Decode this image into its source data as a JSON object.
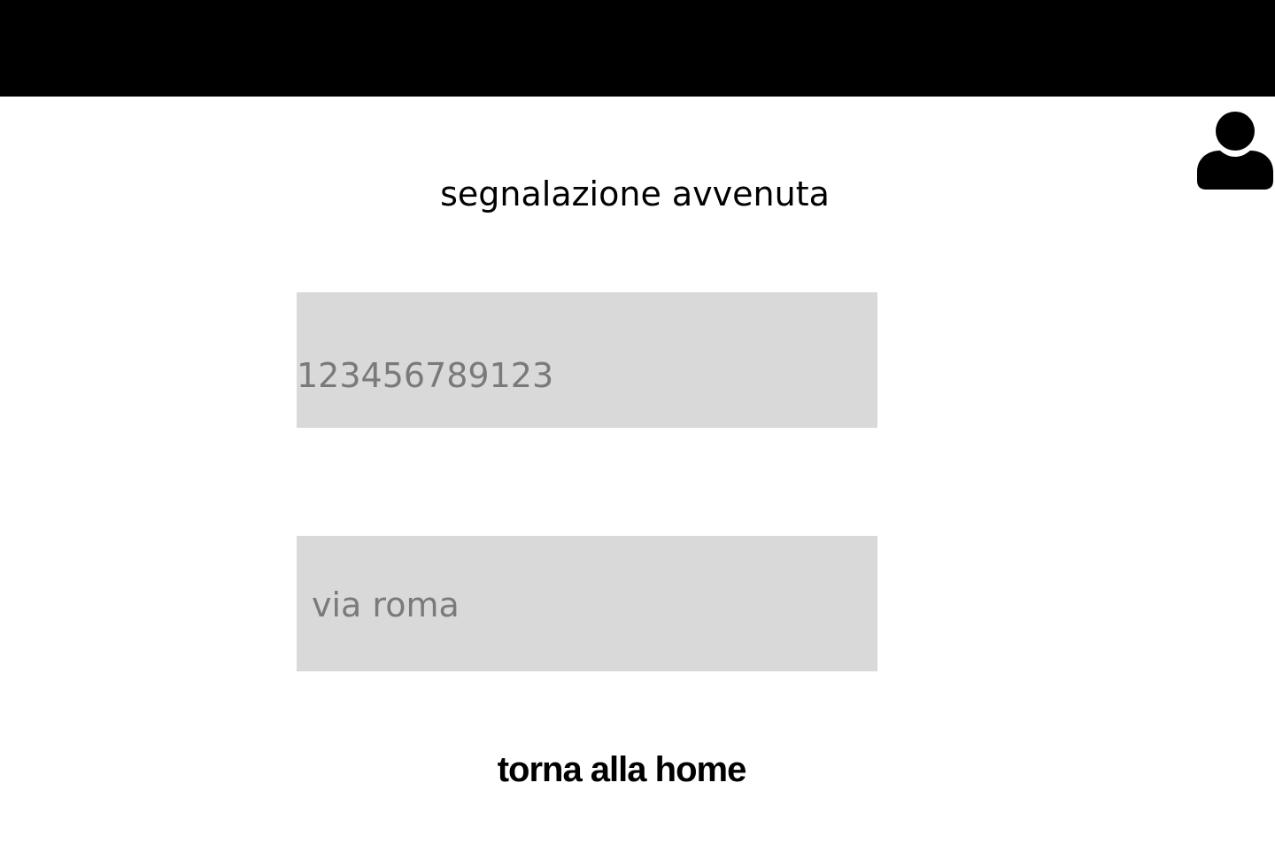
{
  "header": {
    "background_color": "#000000",
    "avatar_icon": "user-icon"
  },
  "main": {
    "title": "segnalazione avvenuta",
    "code_field": {
      "value": "123456789123"
    },
    "street_field": {
      "value": "via roma"
    },
    "home_link_label": "torna alla home"
  },
  "colors": {
    "field_background": "#d9d9d9",
    "field_text": "#7a7a7a",
    "text": "#000000"
  }
}
